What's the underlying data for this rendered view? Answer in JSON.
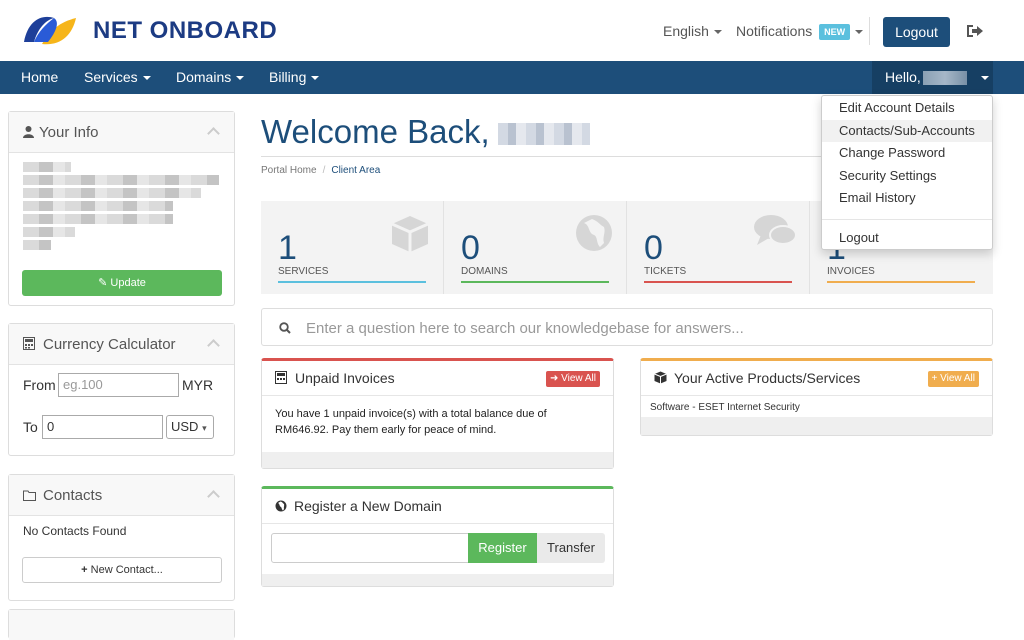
{
  "brand": {
    "name": "NET ONBOARD"
  },
  "topbar": {
    "language": "English",
    "notifications": "Notifications",
    "new_badge": "NEW",
    "logout": "Logout"
  },
  "nav": {
    "home": "Home",
    "services": "Services",
    "domains": "Domains",
    "billing": "Billing",
    "hello": "Hello,"
  },
  "account_menu": {
    "items": [
      "Edit Account Details",
      "Contacts/Sub-Accounts",
      "Change Password",
      "Security Settings",
      "Email History"
    ],
    "logout": "Logout"
  },
  "sidebar": {
    "your_info": {
      "title": "Your Info",
      "update": "Update"
    },
    "currency": {
      "title": "Currency Calculator",
      "from_label": "From",
      "from_placeholder": "eg.100",
      "from_currency": "MYR",
      "to_label": "To",
      "to_value": "0",
      "to_currency": "USD"
    },
    "contacts": {
      "title": "Contacts",
      "empty": "No Contacts Found",
      "new_contact": "New Contact..."
    }
  },
  "main": {
    "welcome": "Welcome Back,",
    "breadcrumb": [
      "Portal Home",
      "Client Area"
    ],
    "stats": [
      {
        "value": "1",
        "label": "SERVICES",
        "color": "#5bc0de",
        "icon": "cube-icon"
      },
      {
        "value": "0",
        "label": "DOMAINS",
        "color": "#5cb85c",
        "icon": "globe-icon"
      },
      {
        "value": "0",
        "label": "TICKETS",
        "color": "#d9534f",
        "icon": "comments-icon"
      },
      {
        "value": "1",
        "label": "INVOICES",
        "color": "#f0ad4e",
        "icon": "card-icon"
      }
    ],
    "search_placeholder": "Enter a question here to search our knowledgebase for answers...",
    "unpaid": {
      "title": "Unpaid Invoices",
      "button": "View All",
      "text": "You have 1 unpaid invoice(s) with a total balance due of RM646.92. Pay them early for peace of mind.",
      "color": "#d9534f"
    },
    "register": {
      "title": "Register a New Domain",
      "register": "Register",
      "transfer": "Transfer",
      "color": "#5cb85c"
    },
    "products": {
      "title": "Your Active Products/Services",
      "button": "View All",
      "item": "Software - ESET Internet Security",
      "color": "#f0ad4e"
    }
  }
}
